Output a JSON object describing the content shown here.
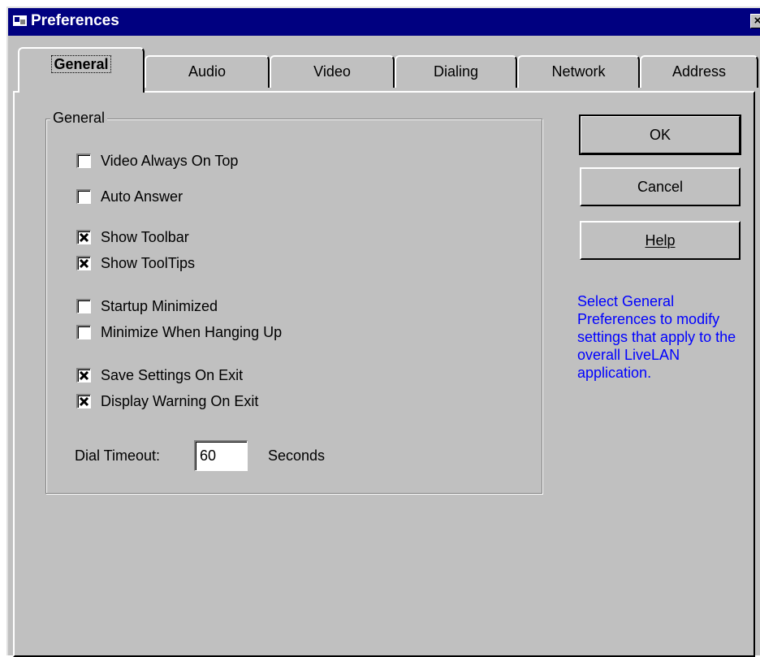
{
  "window": {
    "title": "Preferences",
    "app_icon": "app-window-icon",
    "close_icon": "close-icon",
    "close_glyph": "×"
  },
  "tabs": [
    {
      "label": "General",
      "active": true
    },
    {
      "label": "Audio",
      "active": false
    },
    {
      "label": "Video",
      "active": false
    },
    {
      "label": "Dialing",
      "active": false
    },
    {
      "label": "Network",
      "active": false
    },
    {
      "label": "Address",
      "active": false
    }
  ],
  "general": {
    "group_label": "General",
    "options": [
      {
        "label": "Video Always On Top",
        "checked": false
      },
      {
        "label": "Auto Answer",
        "checked": false
      },
      {
        "label": "Show Toolbar",
        "checked": true
      },
      {
        "label": "Show ToolTips",
        "checked": true
      },
      {
        "label": "Startup Minimized",
        "checked": false
      },
      {
        "label": "Minimize When Hanging Up",
        "checked": false
      },
      {
        "label": "Save Settings On Exit",
        "checked": true
      },
      {
        "label": "Display Warning On Exit",
        "checked": true
      }
    ],
    "dial_timeout_label": "Dial Timeout:",
    "dial_timeout_value": "60",
    "dial_timeout_unit": "Seconds"
  },
  "buttons": {
    "ok": "OK",
    "cancel": "Cancel",
    "help": "Help"
  },
  "help_text": "Select General Preferences to modify settings that apply to the overall LiveLAN application.",
  "colors": {
    "title_bar": "#000080",
    "face": "#c0c0c0",
    "help_text": "#0000ff"
  }
}
